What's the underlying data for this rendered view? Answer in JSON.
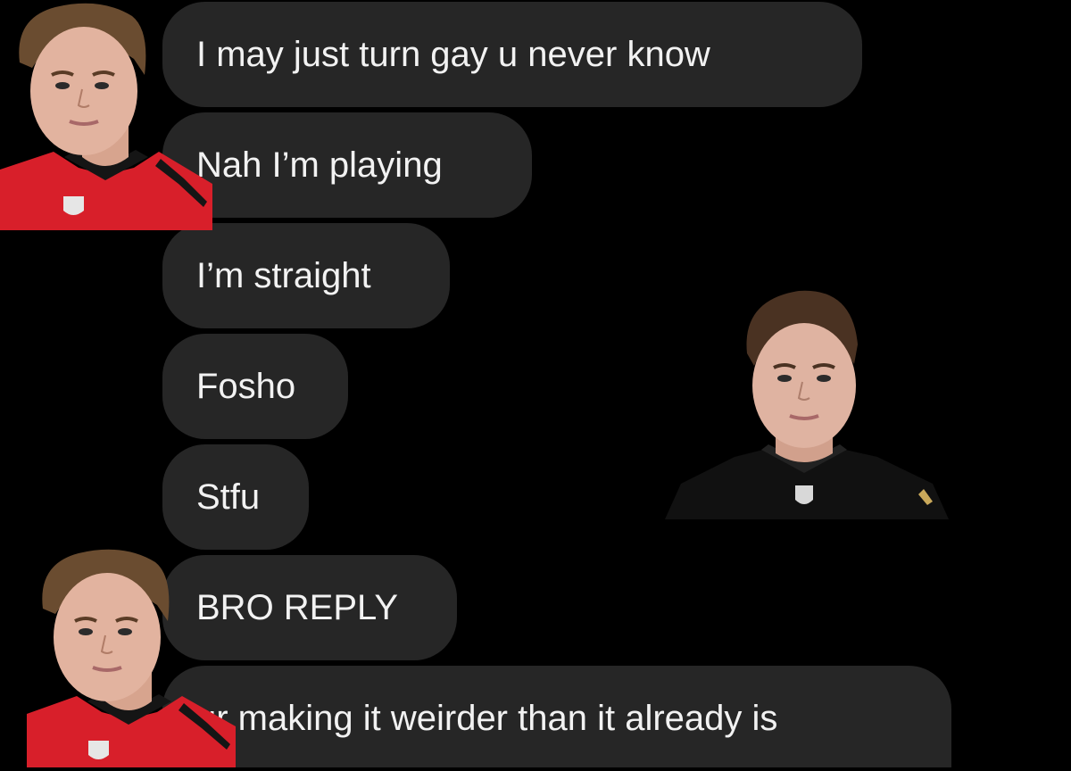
{
  "messages": [
    {
      "text": "I may just turn gay u never know"
    },
    {
      "text": "Nah I’m playing"
    },
    {
      "text": "I’m straight"
    },
    {
      "text": "Fosho"
    },
    {
      "text": "Stfu"
    },
    {
      "text": "BRO REPLY"
    },
    {
      "text": "ur making it weirder than it already is"
    }
  ],
  "colors": {
    "background": "#000000",
    "bubble": "#262626",
    "bubble_text": "#f2f2f2",
    "jersey_red": "#d81f2a",
    "jersey_black": "#111111"
  },
  "overlays": [
    {
      "icon": "player-photo-red-jersey"
    },
    {
      "icon": "player-photo-red-jersey"
    },
    {
      "icon": "player-photo-black-jersey"
    }
  ]
}
